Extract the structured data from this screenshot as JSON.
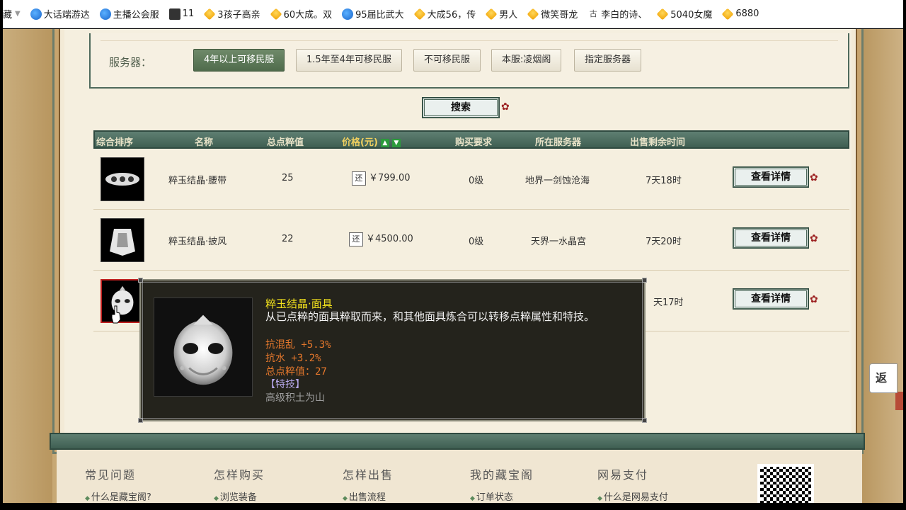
{
  "bookmarks": [
    {
      "label": "藏",
      "icon": "folder-icon"
    },
    {
      "label": "大话端游达",
      "icon": "e-browser-icon"
    },
    {
      "label": "主播公会服",
      "icon": "e-browser-icon"
    },
    {
      "label": "11",
      "icon": "page-icon"
    },
    {
      "label": "3孩子高亲",
      "icon": "star-icon"
    },
    {
      "label": "60大成。双",
      "icon": "star-icon"
    },
    {
      "label": "95届比武大",
      "icon": "e-browser-icon"
    },
    {
      "label": "大成56，传",
      "icon": "star-icon"
    },
    {
      "label": "男人",
      "icon": "star-icon"
    },
    {
      "label": "微笑哥龙",
      "icon": "star-icon"
    },
    {
      "label": "李白的诗、",
      "icon": "ku-icon"
    },
    {
      "label": "5040女魔",
      "icon": "star-icon"
    },
    {
      "label": "6880",
      "icon": "star-icon"
    }
  ],
  "filter": {
    "server_label": "服务器：",
    "options": [
      {
        "label": "4年以上可移民服",
        "active": true
      },
      {
        "label": "1.5年至4年可移民服",
        "active": false
      },
      {
        "label": "不可移民服",
        "active": false
      },
      {
        "label": "本服:凌烟阁",
        "active": false
      },
      {
        "label": "指定服务器",
        "active": false
      }
    ],
    "search_label": "搜索"
  },
  "table": {
    "headers": {
      "rank": "综合排序",
      "name": "名称",
      "points": "总点粹值",
      "price": "价格(元)",
      "requirement": "购买要求",
      "server": "所在服务器",
      "time_left": "出售剩余时间"
    },
    "rows": [
      {
        "name": "粹玉结晶·腰带",
        "points": "25",
        "price": "￥799.00",
        "badge": "还",
        "requirement": "0级",
        "server": "地界一剑蚀沧海",
        "time_left": "7天18时",
        "action": "查看详情"
      },
      {
        "name": "粹玉结晶·披风",
        "points": "22",
        "price": "￥4500.00",
        "badge": "还",
        "requirement": "0级",
        "server": "天界一水晶宫",
        "time_left": "7天20时",
        "action": "查看详情"
      },
      {
        "name": "",
        "points": "",
        "price": "",
        "badge": "",
        "requirement": "",
        "server": "",
        "time_left": "天17时",
        "action": "查看详情"
      }
    ]
  },
  "tooltip": {
    "title": "粹玉结晶·面具",
    "description": "从已点粹的面具粹取而来，和其他面具炼合可以转移点粹属性和特技。",
    "stat1": "抗混乱 +5.3%",
    "stat2": "抗水 +3.2%",
    "total": "总点粹值：27",
    "skill_header": "【特技】",
    "skill_name": "高级积土为山"
  },
  "footer": {
    "columns": [
      {
        "head": "常见问题",
        "link": "什么是藏宝阁?"
      },
      {
        "head": "怎样购买",
        "link": "浏览装备"
      },
      {
        "head": "怎样出售",
        "link": "出售流程"
      },
      {
        "head": "我的藏宝阁",
        "link": "订单状态"
      },
      {
        "head": "网易支付",
        "link": "什么是网易支付"
      }
    ]
  },
  "back_label": "返",
  "colors": {
    "accent_green": "#4f6b4c",
    "tooltip_title": "#f3e21c",
    "stat_orange": "#e6782c",
    "skill_lavender": "#b6a7ea"
  }
}
